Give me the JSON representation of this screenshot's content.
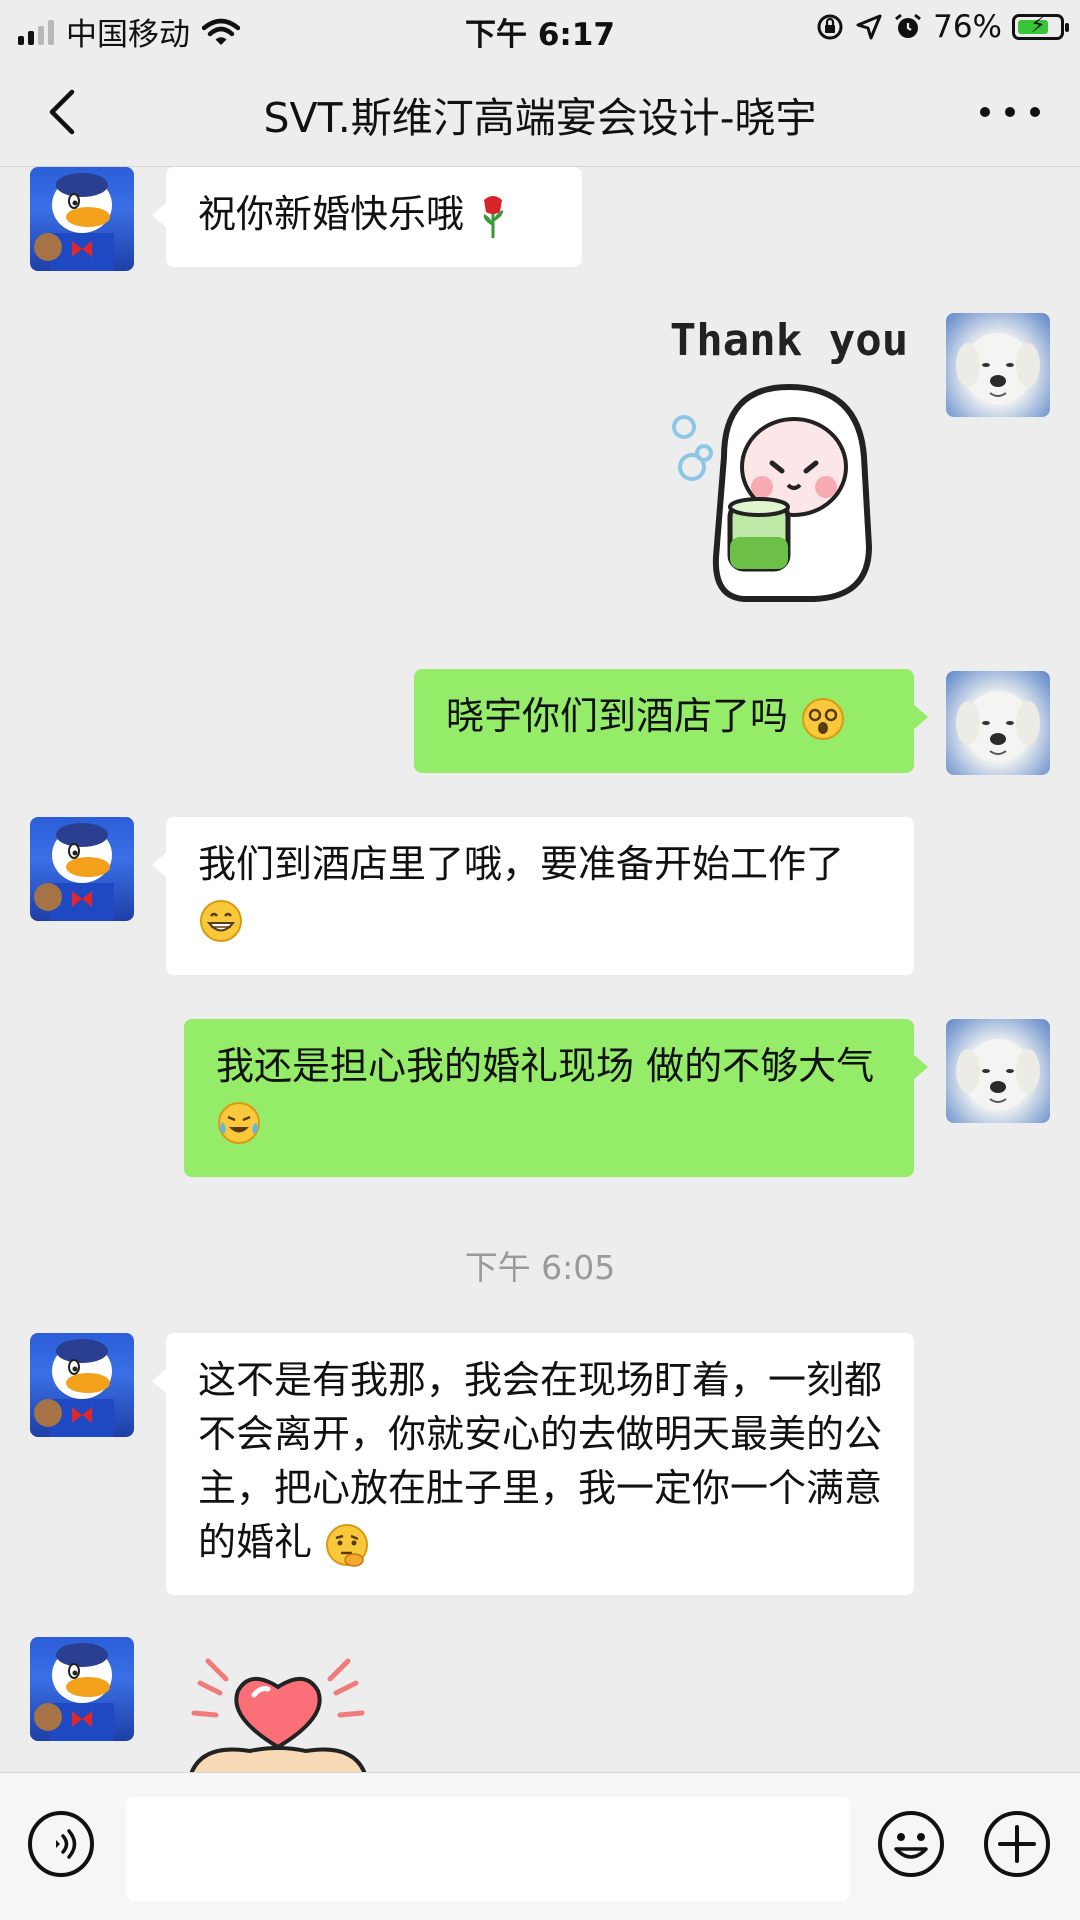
{
  "status_bar": {
    "carrier": "中国移动",
    "time": "下午 6:17",
    "battery_percent_text": "76%",
    "battery_level": 0.76,
    "icons": [
      "signal-icon",
      "wifi-icon",
      "orientation-lock-icon",
      "location-icon",
      "alarm-icon",
      "battery-charging-icon"
    ]
  },
  "nav": {
    "title": "SVT.斯维汀高端宴会设计-晓宇",
    "back_icon": "chevron-left-icon",
    "more_icon": "more-dots-icon"
  },
  "messages": [
    {
      "side": "left",
      "avatar": "duck-avatar",
      "text": "祝你新婚快乐哦",
      "emoji": "rose-icon"
    },
    {
      "side": "right",
      "avatar": "puppy-avatar",
      "sticker": "thank-you-sticker",
      "sticker_text": "Thank you"
    },
    {
      "side": "right",
      "avatar": "puppy-avatar",
      "text": "晓宇你们到酒店了吗",
      "emoji": "dizzy-face-icon"
    },
    {
      "side": "left",
      "avatar": "duck-avatar",
      "text": "我们到酒店里了哦，要准备开始工作了",
      "emoji": "grin-icon"
    },
    {
      "side": "right",
      "avatar": "puppy-avatar",
      "text": "我还是担心我的婚礼现场  做的不够大气",
      "emoji": "crying-laugh-icon"
    },
    {
      "type": "timestamp",
      "text": "下午 6:05"
    },
    {
      "side": "left",
      "avatar": "duck-avatar",
      "text": "这不是有我那，我会在现场盯着，一刻都不会离开，你就安心的去做明天最美的公主，把心放在肚子里，我一定你一个满意的婚礼",
      "emoji": "thinking-face-icon"
    },
    {
      "side": "left",
      "avatar": "duck-avatar",
      "sticker": "heart-pig-sticker"
    }
  ],
  "input_bar": {
    "voice_icon": "voice-icon",
    "input_value": "",
    "emoji_icon": "smiley-icon",
    "add_icon": "plus-icon"
  },
  "colors": {
    "background": "#ededed",
    "self_bubble": "#95ec69",
    "other_bubble": "#ffffff",
    "timestamp": "#9a9a9a"
  }
}
